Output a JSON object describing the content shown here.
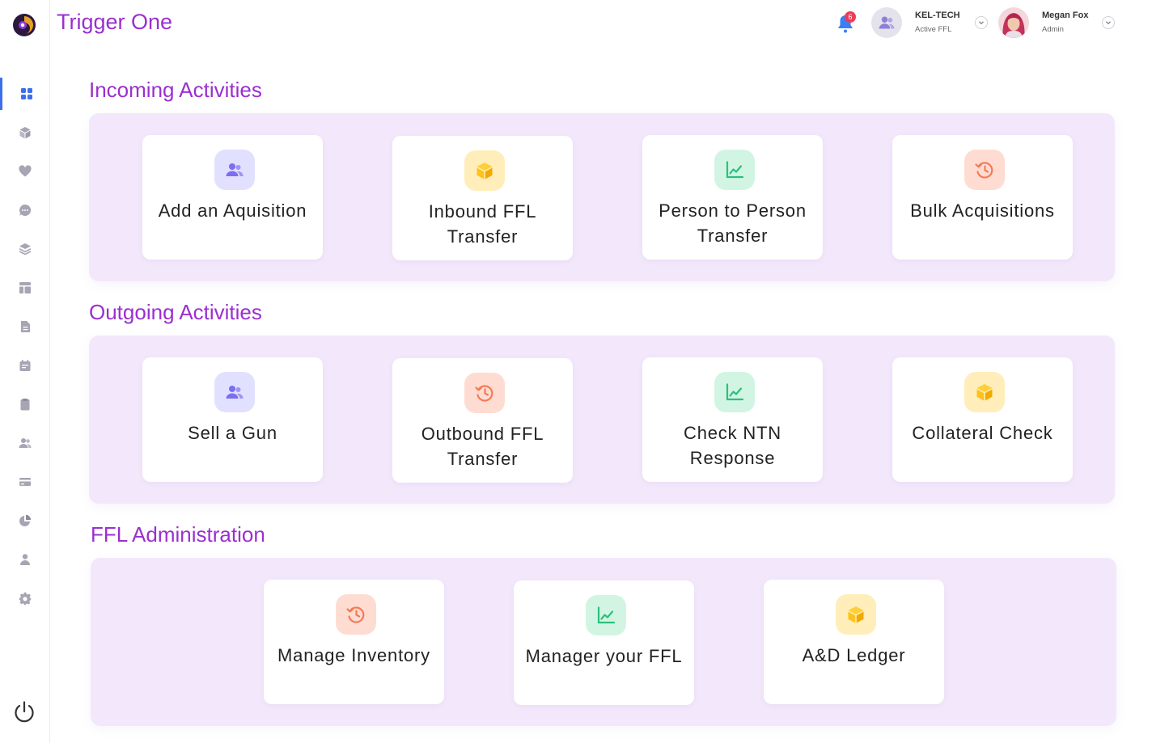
{
  "app": {
    "title": "Trigger One"
  },
  "header": {
    "notification_count": "6",
    "org": {
      "name": "KEL-TECH",
      "subtitle": "Active FFL"
    },
    "user": {
      "name": "Megan Fox",
      "role": "Admin"
    }
  },
  "sidebar": {
    "items": [
      {
        "name": "dashboard",
        "icon": "grid-icon",
        "active": true
      },
      {
        "name": "packages",
        "icon": "cube-icon",
        "active": false
      },
      {
        "name": "favorites",
        "icon": "heart-icon",
        "active": false
      },
      {
        "name": "messages",
        "icon": "chat-icon",
        "active": false
      },
      {
        "name": "layers",
        "icon": "layers-icon",
        "active": false
      },
      {
        "name": "layout",
        "icon": "layout-icon",
        "active": false
      },
      {
        "name": "documents",
        "icon": "document-icon",
        "active": false
      },
      {
        "name": "calendar",
        "icon": "calendar-icon",
        "active": false
      },
      {
        "name": "clipboard",
        "icon": "clipboard-icon",
        "active": false
      },
      {
        "name": "users",
        "icon": "users-icon",
        "active": false
      },
      {
        "name": "billing",
        "icon": "credit-card-icon",
        "active": false
      },
      {
        "name": "reports",
        "icon": "pie-chart-icon",
        "active": false
      },
      {
        "name": "profile",
        "icon": "user-icon",
        "active": false
      },
      {
        "name": "settings",
        "icon": "gear-icon",
        "active": false
      }
    ]
  },
  "sections": {
    "incoming": {
      "title": "Incoming Activities",
      "cards": [
        {
          "label": "Add an Aquisition",
          "icon": "users-icon",
          "color": "purple"
        },
        {
          "label": "Inbound FFL Transfer",
          "icon": "cube-icon",
          "color": "yellow"
        },
        {
          "label": "Person to Person Transfer",
          "icon": "chart-icon",
          "color": "green"
        },
        {
          "label": "Bulk Acquisitions",
          "icon": "history-icon",
          "color": "orange"
        }
      ]
    },
    "outgoing": {
      "title": "Outgoing Activities",
      "cards": [
        {
          "label": "Sell a Gun",
          "icon": "users-icon",
          "color": "purple"
        },
        {
          "label": "Outbound FFL Transfer",
          "icon": "history-icon",
          "color": "orange"
        },
        {
          "label": "Check NTN Response",
          "icon": "chart-icon",
          "color": "green"
        },
        {
          "label": "Collateral Check",
          "icon": "cube-icon",
          "color": "yellow"
        }
      ]
    },
    "admin": {
      "title": "FFL Administration",
      "cards": [
        {
          "label": "Manage Inventory",
          "icon": "history-icon",
          "color": "orange"
        },
        {
          "label": "Manager your FFL",
          "icon": "chart-icon",
          "color": "green"
        },
        {
          "label": "A&D Ledger",
          "icon": "cube-icon",
          "color": "yellow"
        }
      ]
    }
  },
  "colors": {
    "brand": "#9b2fd0",
    "panel": "#f3e8fb",
    "active_nav": "#3a6ff0",
    "badge": "#ee3b55"
  }
}
